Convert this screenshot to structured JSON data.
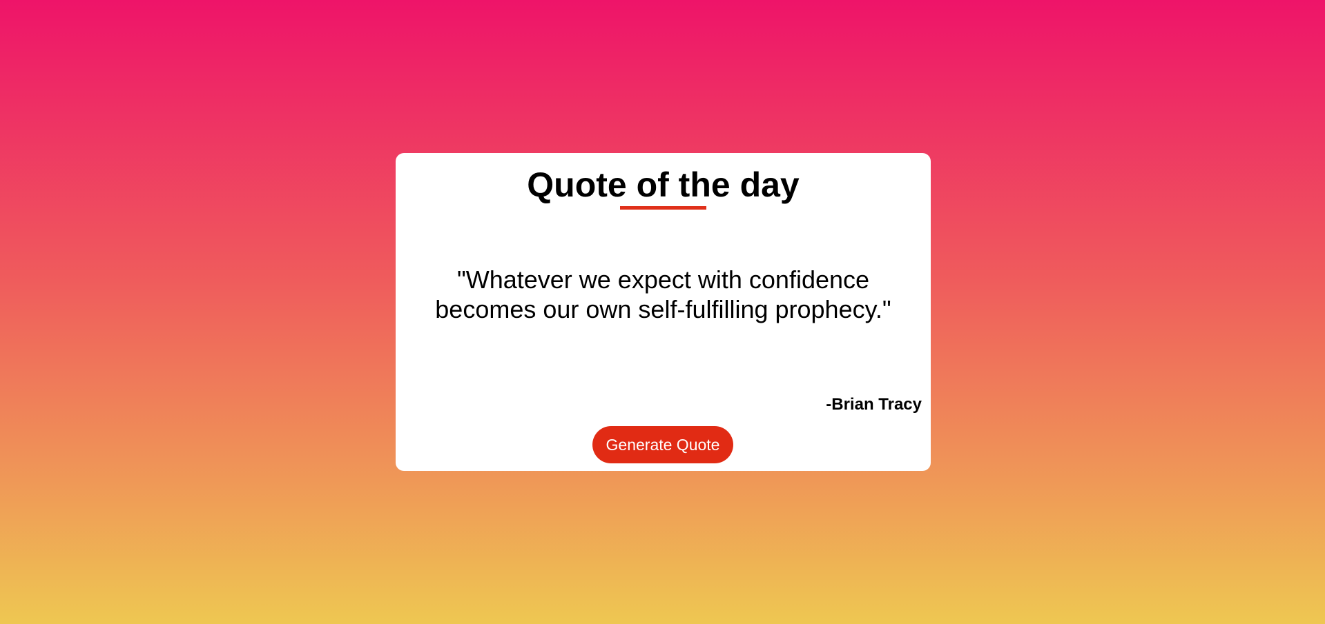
{
  "card": {
    "title": "Quote of the day",
    "quote": "\"Whatever we expect with confidence becomes our own self-fulfilling prophecy.\"",
    "author": "-Brian Tracy",
    "button_label": "Generate Quote"
  },
  "colors": {
    "background_gradient": [
      "#EE1469",
      "#EF5C5C",
      "#EF9A57",
      "#EEC752"
    ],
    "card_background": "#FFFFFF",
    "accent": "#E0301A",
    "button_background": "#E12B14",
    "button_text": "#FFFFFF",
    "text": "#000000"
  }
}
